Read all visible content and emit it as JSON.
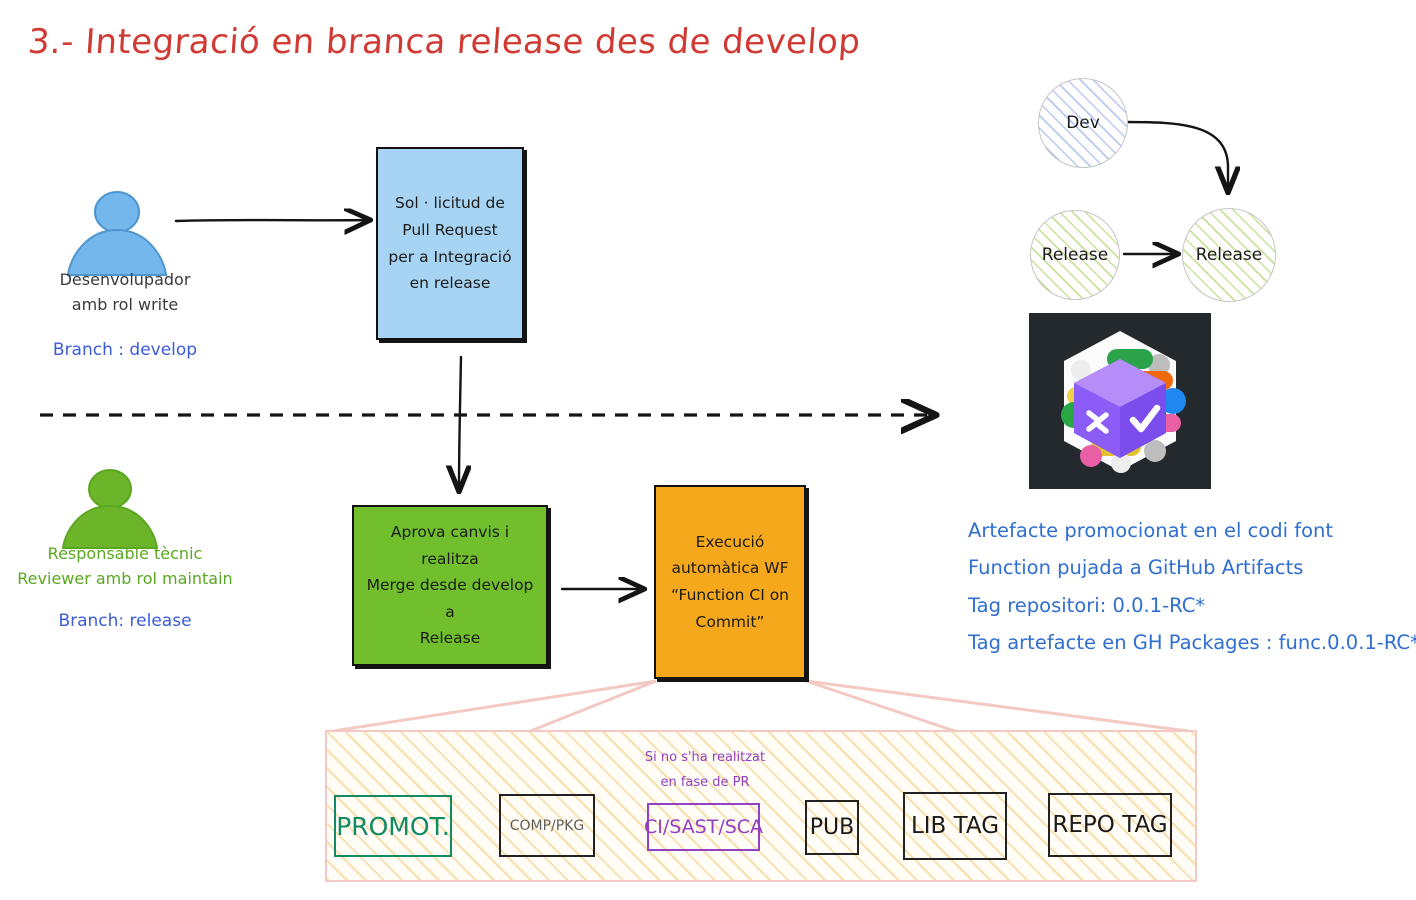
{
  "title": "3.- Integració en branca release des de develop",
  "colors": {
    "title": "#d03a32",
    "pr_box": "#a6d4f2",
    "merge_box": "#71bf2c",
    "wf_box": "#f5a81c",
    "branch_label": "#3b5bdb",
    "notes": "#2f6fd0",
    "promot": "#128a63",
    "ci_sast_sca": "#9240c4",
    "panel_border": "#f3c9c4",
    "panel_hatch": "#fadfae"
  },
  "actors": {
    "developer": {
      "icon": "person-icon",
      "role_line1": "Desenvolupador",
      "role_line2": "amb rol write",
      "branch": "Branch : develop"
    },
    "tech_lead": {
      "icon": "person-icon",
      "role_line1": "Responsable tècnic",
      "role_line2": "Reviewer amb rol maintain",
      "branch": "Branch: release"
    }
  },
  "boxes": {
    "pull_request": {
      "line1": "Sol · licitud de",
      "line2": "Pull Request",
      "line3": "per a Integració",
      "line4": "en release"
    },
    "merge": {
      "line1": "Aprova canvis i realitza",
      "line2": "Merge desde develop a",
      "line3": "Release"
    },
    "workflow": {
      "line1": "Execució",
      "line2": "automàtica WF",
      "line3": "“Function CI on",
      "line4": "Commit”"
    }
  },
  "branch_graph": {
    "nodes": [
      {
        "label": "Dev",
        "hatch": "blue"
      },
      {
        "label": "Release",
        "hatch": "green"
      },
      {
        "label": "Release",
        "hatch": "green"
      }
    ]
  },
  "logo": {
    "name": "github-packages-logo",
    "alt": "GitHub Packages"
  },
  "notes": [
    "Artefacte promocionat en el codi font",
    "Function pujada a GitHub Artifacts",
    "Tag repositori: 0.0.1-RC*",
    "Tag artefacte en GH Packages : func.0.0.1-RC*"
  ],
  "pipeline": {
    "annotation_line1": "Si no s'ha realitzat",
    "annotation_line2": "en fase de PR",
    "steps": [
      {
        "label": "PROMOT.",
        "color": "#128a63"
      },
      {
        "label": "COMP/PKG",
        "color": "#5f5f5f"
      },
      {
        "label": "CI/SAST/SCA",
        "color": "#9240c4"
      },
      {
        "label": "PUB",
        "color": "#1b1b1b"
      },
      {
        "label": "LIB TAG",
        "color": "#1b1b1b"
      },
      {
        "label": "REPO TAG",
        "color": "#1b1b1b"
      }
    ]
  }
}
